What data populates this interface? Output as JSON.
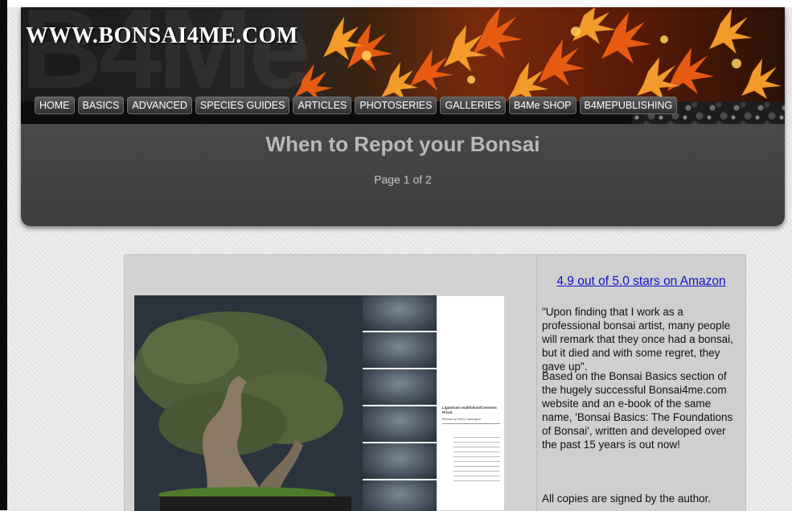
{
  "site": {
    "title": "WWW.BONSAI4ME.COM",
    "watermark": "B4Me"
  },
  "nav": {
    "items": [
      "HOME",
      "BASICS",
      "ADVANCED",
      "SPECIES GUIDES",
      "ARTICLES",
      "PHOTOSERIES",
      "GALLERIES",
      "B4Me SHOP",
      "B4MEPUBLISHING"
    ]
  },
  "page": {
    "title": "When to Repot your Bonsai",
    "page_indicator": "Page 1 of 2"
  },
  "sidebar": {
    "rating_link": "4.9 out of 5.0 stars on Amazon",
    "quote": "\"Upon finding that I work as a professional bonsai artist, many people will remark that they once had a bonsai, but it died and with some regret, they gave up\".",
    "description": "Based on the Bonsai Basics section of the hugely successful Bonsai4me.com website and an e-book of the same name, 'Bonsai Basics: The Foundations of Bonsai', written and developed over the past 15 years is out now!",
    "signed_note": "All copies are signed by the author."
  },
  "book": {
    "caption_title": "Ligustrum ovalifolium/Common Privet",
    "caption_subtitle": "Bonsai by Harry Harrington"
  },
  "colors": {
    "link": "#1111cc",
    "header_bg": "#474747",
    "content_bg": "#d3d3d3"
  }
}
